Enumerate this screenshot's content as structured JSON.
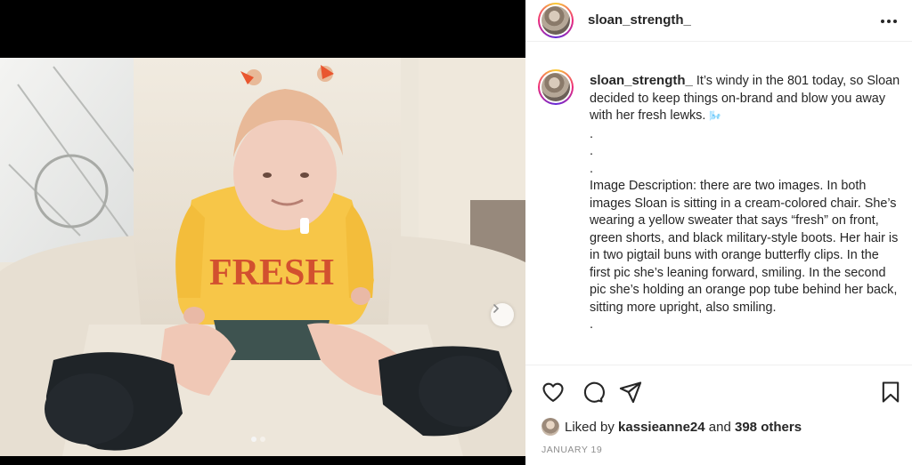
{
  "post": {
    "username": "sloan_strength_",
    "more_label": "More options",
    "media": {
      "sweater_text": "FRESH",
      "carousel_position": 1,
      "carousel_total": 2
    },
    "caption": {
      "username": "sloan_strength_",
      "text": "It’s windy in the 801 today, so Sloan decided to keep things on-brand and blow you away with her fresh lewks.",
      "emoji": "🌬️",
      "dots": [
        ".",
        ".",
        "."
      ],
      "description": "Image Description: there are two images. In both images Sloan is sitting in a cream-colored chair. She’s wearing a yellow sweater that says “fresh” on front, green shorts, and black military-style boots. Her hair is in two pigtail buns with orange butterfly clips. In the first pic she’s leaning forward, smiling. In the second pic she’s holding an orange pop tube behind her back, sitting more upright, also smiling.",
      "trailing_dot": "."
    },
    "actions": {
      "like_icon": "heart-icon",
      "comment_icon": "comment-icon",
      "share_icon": "paper-plane-icon",
      "save_icon": "bookmark-icon"
    },
    "likes": {
      "prefix": "Liked by ",
      "user": "kassieanne24",
      "middle": " and ",
      "others": "398 others"
    },
    "date": "JANUARY 19"
  },
  "colors": {
    "sweater": "#f7c648",
    "sweater_text": "#d2502f",
    "shorts": "#3e5350",
    "boots": "#1f2428",
    "chair": "#ece5d9"
  }
}
